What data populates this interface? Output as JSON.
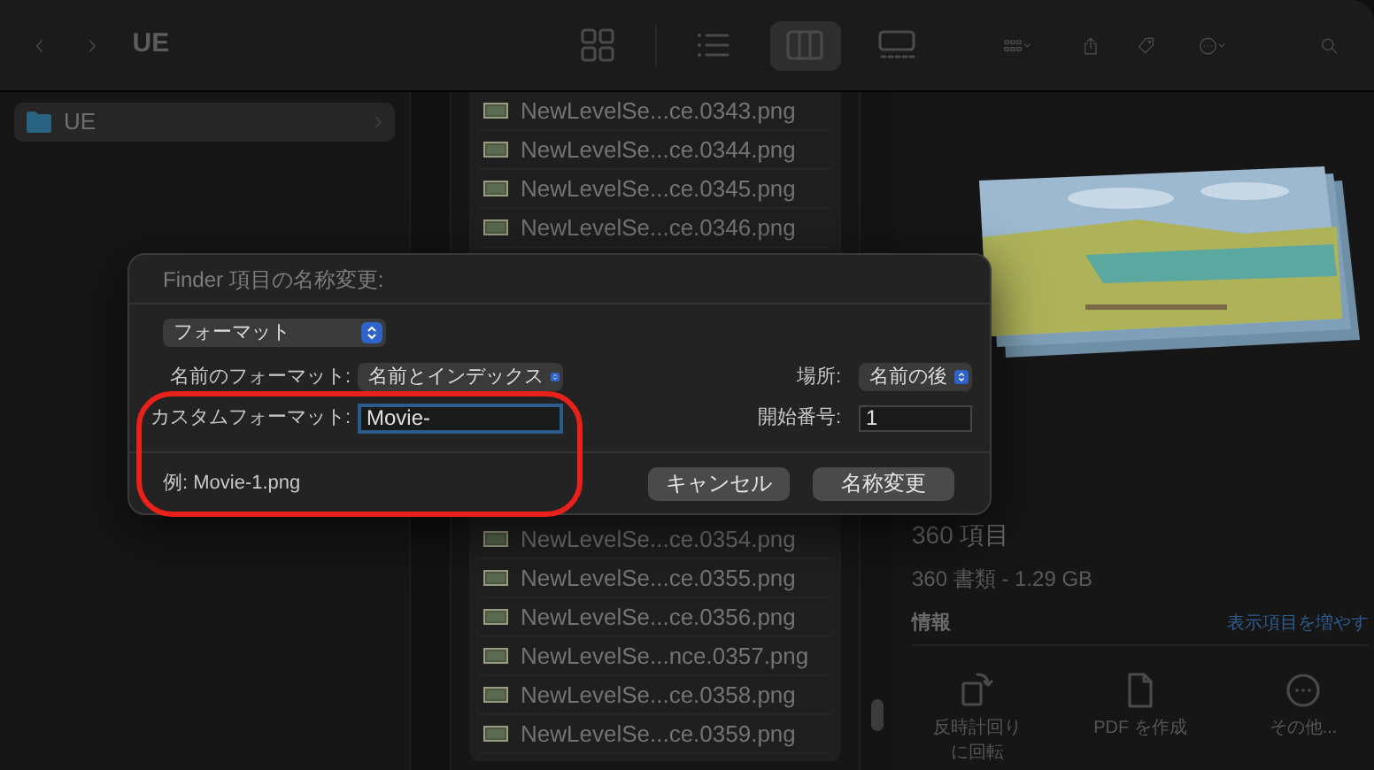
{
  "window": {
    "title": "UE"
  },
  "toolbar": {
    "view_modes": [
      {
        "kind": "icons",
        "selected": false
      },
      {
        "kind": "list",
        "selected": false
      },
      {
        "kind": "columns",
        "selected": true
      },
      {
        "kind": "gallery",
        "selected": false
      }
    ]
  },
  "sidebar": {
    "items": [
      {
        "label": "UE",
        "selected": true
      }
    ]
  },
  "files": {
    "upper": [
      "NewLevelSe...ce.0343.png",
      "NewLevelSe...ce.0344.png",
      "NewLevelSe...ce.0345.png",
      "NewLevelSe...ce.0346.png"
    ],
    "lower": [
      "NewLevelSe...ce.0354.png",
      "NewLevelSe...ce.0355.png",
      "NewLevelSe...ce.0356.png",
      "NewLevelSe...nce.0357.png",
      "NewLevelSe...ce.0358.png",
      "NewLevelSe...ce.0359.png"
    ]
  },
  "preview": {
    "item_count": "360 項目",
    "summary": "360 書類 - 1.29 GB",
    "info_heading": "情報",
    "show_more": "表示項目を増やす",
    "actions": [
      {
        "kind": "rotate",
        "lines": [
          "反時計回り",
          "に回転"
        ]
      },
      {
        "kind": "pdf",
        "lines": [
          "PDF を作成"
        ]
      },
      {
        "kind": "more",
        "lines": [
          "その他..."
        ]
      }
    ]
  },
  "dialog": {
    "title": "Finder 項目の名称変更:",
    "mode": "フォーマット",
    "name_format": {
      "label": "名前のフォーマット:",
      "value": "名前とインデックス"
    },
    "location": {
      "label": "場所:",
      "value": "名前の後"
    },
    "custom_format": {
      "label": "カスタムフォーマット:",
      "value": "Movie-",
      "focused": true
    },
    "start_number": {
      "label": "開始番号:",
      "value": "1"
    },
    "example": "例: Movie-1.png",
    "buttons": [
      "キャンセル",
      "名称変更"
    ]
  }
}
